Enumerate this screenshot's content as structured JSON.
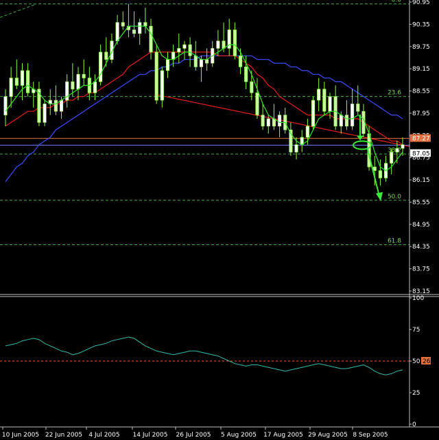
{
  "chart_data": [
    {
      "type": "candlestick",
      "title": "",
      "ylim": [
        83.15,
        90.95
      ],
      "y_ticks": [
        "90.95",
        "90.35",
        "89.75",
        "89.15",
        "88.55",
        "87.95",
        "87.35",
        "86.75",
        "86.15",
        "85.55",
        "84.95",
        "84.35",
        "83.75",
        "83.15"
      ],
      "x_ticks": [
        "10 Jun 2005",
        "22 Jun 2005",
        "4 Jul 2005",
        "14 Jul 2005",
        "26 Jul 2005",
        "5 Aug 2005",
        "17 Aug 2005",
        "29 Aug 2005",
        "8 Sep 2005"
      ],
      "fib_levels": [
        {
          "label": "0.0",
          "value": 90.9
        },
        {
          "label": "23.6",
          "value": 88.4
        },
        {
          "label": "38.2",
          "value": 86.85
        },
        {
          "label": "50.0",
          "value": 85.6
        },
        {
          "label": "61.8",
          "value": 84.4
        }
      ],
      "price_labels": [
        {
          "text": "87.27",
          "value": 87.27,
          "color": "#e07040"
        },
        {
          "text": "87.05",
          "value": 87.05,
          "color": "#ffffff"
        }
      ],
      "ohlc": [
        [
          87.9,
          88.6,
          87.6,
          88.4
        ],
        [
          88.4,
          89.2,
          88.1,
          88.9
        ],
        [
          88.9,
          89.4,
          88.6,
          88.7
        ],
        [
          88.7,
          89.3,
          88.3,
          89.1
        ],
        [
          89.1,
          89.3,
          88.4,
          88.5
        ],
        [
          88.5,
          88.8,
          88.1,
          88.6
        ],
        [
          88.6,
          88.8,
          87.6,
          87.7
        ],
        [
          87.7,
          88.3,
          87.6,
          88.2
        ],
        [
          88.2,
          88.6,
          87.9,
          88.3
        ],
        [
          88.3,
          88.7,
          87.9,
          88.0
        ],
        [
          88.0,
          88.4,
          87.8,
          88.3
        ],
        [
          88.3,
          89.0,
          88.1,
          88.8
        ],
        [
          88.8,
          89.3,
          88.4,
          88.6
        ],
        [
          88.6,
          89.2,
          88.3,
          89.0
        ],
        [
          89.0,
          89.4,
          88.7,
          88.9
        ],
        [
          88.9,
          89.2,
          88.3,
          88.5
        ],
        [
          88.5,
          89.0,
          88.3,
          88.8
        ],
        [
          88.8,
          89.8,
          88.7,
          89.6
        ],
        [
          89.6,
          90.0,
          89.2,
          89.4
        ],
        [
          89.4,
          90.1,
          89.3,
          89.9
        ],
        [
          89.9,
          90.6,
          89.8,
          90.4
        ],
        [
          90.4,
          90.7,
          90.2,
          90.3
        ],
        [
          90.3,
          90.9,
          90.0,
          90.2
        ],
        [
          90.2,
          90.7,
          90.0,
          90.1
        ],
        [
          90.1,
          90.5,
          89.8,
          90.4
        ],
        [
          90.4,
          90.8,
          90.1,
          90.3
        ],
        [
          90.3,
          90.5,
          89.4,
          89.6
        ],
        [
          89.6,
          89.8,
          88.2,
          88.3
        ],
        [
          88.3,
          89.2,
          88.1,
          89.1
        ],
        [
          89.1,
          89.6,
          88.9,
          89.4
        ],
        [
          89.4,
          89.8,
          89.2,
          89.6
        ],
        [
          89.6,
          90.1,
          89.3,
          89.7
        ],
        [
          89.7,
          89.9,
          89.4,
          89.8
        ],
        [
          89.8,
          90.0,
          89.2,
          89.5
        ],
        [
          89.5,
          89.9,
          89.1,
          89.2
        ],
        [
          89.2,
          89.5,
          88.8,
          89.4
        ],
        [
          89.4,
          89.7,
          89.1,
          89.3
        ],
        [
          89.3,
          89.9,
          89.2,
          89.7
        ],
        [
          89.7,
          90.2,
          89.5,
          89.9
        ],
        [
          89.9,
          90.4,
          89.6,
          89.7
        ],
        [
          89.7,
          90.5,
          89.5,
          90.2
        ],
        [
          90.2,
          90.4,
          89.4,
          89.5
        ],
        [
          89.5,
          89.7,
          89.0,
          89.2
        ],
        [
          89.2,
          89.5,
          88.6,
          88.8
        ],
        [
          88.8,
          89.1,
          88.3,
          88.5
        ],
        [
          88.5,
          88.9,
          87.8,
          87.9
        ],
        [
          87.9,
          88.2,
          87.5,
          87.6
        ],
        [
          87.6,
          87.9,
          87.4,
          87.8
        ],
        [
          87.8,
          88.2,
          87.5,
          87.6
        ],
        [
          87.6,
          88.0,
          87.3,
          87.9
        ],
        [
          87.9,
          88.1,
          87.4,
          87.5
        ],
        [
          87.5,
          87.7,
          86.8,
          86.9
        ],
        [
          86.9,
          87.3,
          86.7,
          87.1
        ],
        [
          87.1,
          87.5,
          86.9,
          87.3
        ],
        [
          87.3,
          87.8,
          87.1,
          87.6
        ],
        [
          87.6,
          88.4,
          87.5,
          88.3
        ],
        [
          88.3,
          88.9,
          88.0,
          88.6
        ],
        [
          88.6,
          88.8,
          87.9,
          88.0
        ],
        [
          88.0,
          88.5,
          87.8,
          88.4
        ],
        [
          88.4,
          88.7,
          87.5,
          87.6
        ],
        [
          87.6,
          88.0,
          87.4,
          87.9
        ],
        [
          87.9,
          88.3,
          87.5,
          87.6
        ],
        [
          87.6,
          88.6,
          87.5,
          88.2
        ],
        [
          88.2,
          88.7,
          87.9,
          88.0
        ],
        [
          88.0,
          88.2,
          87.3,
          87.4
        ],
        [
          87.4,
          87.6,
          86.4,
          86.5
        ],
        [
          86.5,
          86.8,
          86.0,
          86.4
        ],
        [
          86.4,
          86.7,
          86.0,
          86.2
        ],
        [
          86.2,
          86.8,
          86.1,
          86.6
        ],
        [
          86.6,
          87.0,
          86.3,
          86.9
        ],
        [
          86.9,
          87.2,
          86.6,
          87.0
        ],
        [
          87.0,
          87.3,
          86.8,
          87.1
        ]
      ],
      "ma_fast": [
        88.0,
        88.2,
        88.4,
        88.6,
        88.7,
        88.6,
        88.5,
        88.3,
        88.2,
        88.2,
        88.3,
        88.4,
        88.5,
        88.6,
        88.7,
        88.7,
        88.8,
        89.0,
        89.3,
        89.6,
        89.9,
        90.1,
        90.3,
        90.3,
        90.3,
        90.3,
        90.1,
        89.8,
        89.5,
        89.4,
        89.4,
        89.5,
        89.6,
        89.6,
        89.5,
        89.4,
        89.4,
        89.5,
        89.6,
        89.7,
        89.8,
        89.8,
        89.6,
        89.3,
        89.0,
        88.6,
        88.2,
        87.9,
        87.8,
        87.7,
        87.7,
        87.4,
        87.2,
        87.1,
        87.2,
        87.5,
        87.8,
        87.9,
        88.0,
        88.0,
        87.9,
        87.8,
        87.8,
        87.9,
        87.8,
        87.4,
        86.9,
        86.5,
        86.4,
        86.5,
        86.7,
        86.9
      ],
      "ma_mid": [
        87.6,
        87.7,
        87.8,
        87.9,
        88.0,
        88.0,
        88.1,
        88.1,
        88.1,
        88.2,
        88.2,
        88.3,
        88.3,
        88.4,
        88.4,
        88.5,
        88.5,
        88.6,
        88.7,
        88.8,
        88.9,
        89.0,
        89.2,
        89.3,
        89.4,
        89.5,
        89.6,
        89.6,
        89.6,
        89.6,
        89.6,
        89.6,
        89.6,
        89.6,
        89.6,
        89.6,
        89.6,
        89.6,
        89.5,
        89.5,
        89.5,
        89.5,
        89.4,
        89.3,
        89.2,
        89.0,
        88.9,
        88.7,
        88.6,
        88.4,
        88.3,
        88.2,
        88.1,
        88.0,
        87.9,
        87.9,
        87.9,
        87.9,
        87.9,
        87.8,
        87.8,
        87.8,
        87.8,
        87.8,
        87.7,
        87.6,
        87.5,
        87.4,
        87.3,
        87.2,
        87.2,
        87.1
      ],
      "ma_slow": [
        86.1,
        86.3,
        86.5,
        86.6,
        86.8,
        86.9,
        87.1,
        87.2,
        87.3,
        87.5,
        87.6,
        87.7,
        87.8,
        87.9,
        88.0,
        88.1,
        88.2,
        88.3,
        88.4,
        88.5,
        88.6,
        88.7,
        88.8,
        88.9,
        89.0,
        89.0,
        89.1,
        89.1,
        89.2,
        89.2,
        89.3,
        89.3,
        89.4,
        89.4,
        89.4,
        89.5,
        89.5,
        89.5,
        89.5,
        89.5,
        89.5,
        89.5,
        89.5,
        89.5,
        89.5,
        89.4,
        89.4,
        89.4,
        89.3,
        89.3,
        89.3,
        89.2,
        89.2,
        89.1,
        89.1,
        89.0,
        89.0,
        88.9,
        88.9,
        88.8,
        88.8,
        88.7,
        88.6,
        88.5,
        88.4,
        88.3,
        88.2,
        88.1,
        88.0,
        87.9,
        87.9,
        87.8
      ],
      "trendline": {
        "from": [
          27,
          88.45
        ],
        "to": [
          72,
          87.05
        ]
      }
    },
    {
      "type": "line",
      "title": "",
      "ylim": [
        0,
        100
      ],
      "y_ticks": [
        "100",
        "75",
        "50",
        "25",
        "0"
      ],
      "reference_level": {
        "value": 50,
        "label": "50"
      },
      "last_value_label": "26",
      "series": [
        {
          "values": [
            62,
            63,
            64,
            66,
            67,
            68,
            67,
            64,
            62,
            60,
            58,
            57,
            55,
            56,
            58,
            60,
            62,
            63,
            64,
            66,
            67,
            68,
            69,
            68,
            65,
            62,
            60,
            58,
            57,
            56,
            55,
            56,
            57,
            58,
            58,
            57,
            56,
            55,
            54,
            52,
            50,
            48,
            47,
            46,
            47,
            47,
            46,
            45,
            44,
            43,
            42,
            43,
            44,
            45,
            46,
            47,
            48,
            47,
            46,
            45,
            44,
            44,
            45,
            46,
            47,
            45,
            42,
            40,
            39,
            40,
            42,
            43
          ]
        }
      ]
    }
  ],
  "colors": {
    "candle_up": "#ffffff",
    "candle_down": "#c8f5a0",
    "candle_wick": "#8cff3c",
    "ma_fast": "#39e62d",
    "ma_mid": "#e61c1c",
    "ma_slow": "#3c4cff",
    "fib_line": "#3faa3f",
    "fib_label": "#7ad84d",
    "trendline": "#e61c1c",
    "hline_top": "#e07040",
    "hline_bottom": "#6b7bff",
    "arrow": "#3cea3c",
    "rsi_line": "#33bbaa",
    "rsi_ref": "#ff5522",
    "axis_text": "#ffffff",
    "separator": "#c0c0c0"
  }
}
